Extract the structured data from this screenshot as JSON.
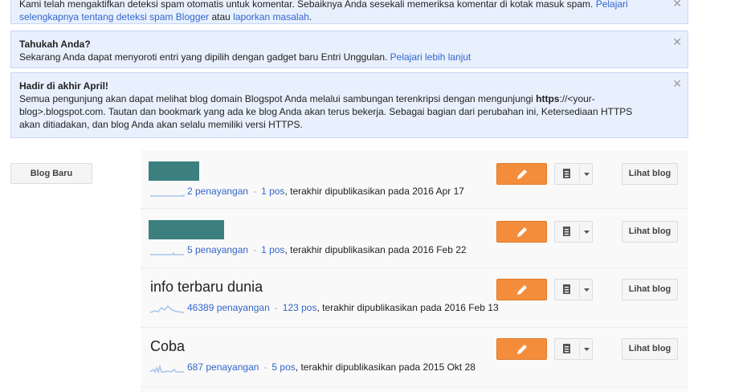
{
  "notices": [
    {
      "title": "",
      "body_a": "Kami telah mengaktifkan deteksi spam otomatis untuk komentar. Sebaiknya Anda sesekali memeriksa komentar di kotak masuk spam. ",
      "link1": "Pelajari selengkapnya tentang deteksi spam Blogger",
      "body_b": " atau ",
      "link2": "laporkan masalah",
      "body_c": "."
    },
    {
      "title": "Tahukah Anda?",
      "body_a": "Sekarang Anda dapat menyoroti entri yang dipilih dengan gadget baru Entri Unggulan. ",
      "link1": "Pelajari lebih lanjut"
    },
    {
      "title": "Hadir di akhir April!",
      "body_a": "Semua pengunjung akan dapat melihat blog domain Blogspot Anda melalui sambungan terenkripsi dengan mengunjungi ",
      "strong": "https",
      "body_b": "://<your-blog>.blogspot.com. Tautan dan bookmark yang ada ke blog Anda akan terus bekerja. Sebagai bagian dari perubahan ini, Ketersediaan HTTPS akan ditiadakan, dan blog Anda akan selalu memiliki versi HTTPS."
    }
  ],
  "close_glyph": "✕",
  "new_blog_label": "Blog Baru",
  "view_blog_label": "Lihat blog",
  "blogs": [
    {
      "name": "",
      "views": "2 penayangan",
      "posts": "1 pos",
      "published": ", terakhir dipublikasikan pada 2016 Apr 17"
    },
    {
      "name": "",
      "views": "5 penayangan",
      "posts": "1 pos",
      "published": ", terakhir dipublikasikan pada 2016 Feb 22"
    },
    {
      "name": "info terbaru dunia",
      "views": "46389 penayangan",
      "posts": "123 pos",
      "published": ", terakhir dipublikasikan pada 2016 Feb 13"
    },
    {
      "name": "Coba",
      "views": "687 penayangan",
      "posts": "5 pos",
      "published": ", terakhir dipublikasikan pada 2015 Okt 28"
    }
  ],
  "separator": "-",
  "colors": {
    "edit": "#f48d3b",
    "link": "#3366cc",
    "notice_bg": "#e8f0fe",
    "redacted": "#3c7f7f"
  }
}
